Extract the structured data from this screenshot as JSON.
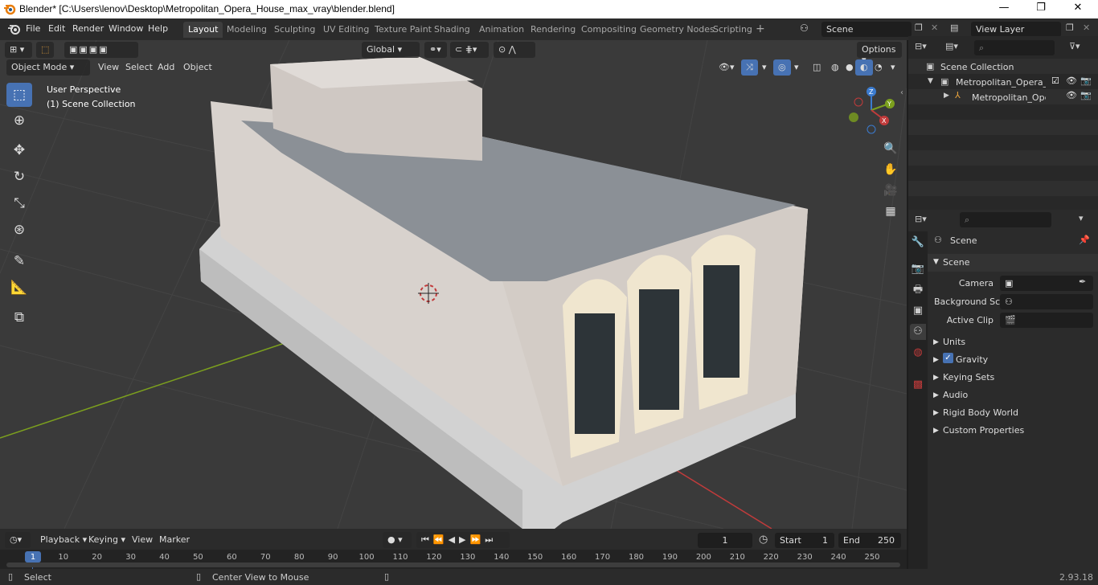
{
  "window": {
    "title": "Blender* [C:\\Users\\lenov\\Desktop\\Metropolitan_Opera_House_max_vray\\blender.blend]",
    "minimize": "—",
    "maximize": "❐",
    "close": "✕"
  },
  "menu": [
    "File",
    "Edit",
    "Render",
    "Window",
    "Help"
  ],
  "workspaces": [
    "Layout",
    "Modeling",
    "Sculpting",
    "UV Editing",
    "Texture Paint",
    "Shading",
    "Animation",
    "Rendering",
    "Compositing",
    "Geometry Nodes",
    "Scripting"
  ],
  "scene": {
    "label": "Scene",
    "view_layer": "View Layer"
  },
  "viewport": {
    "mode": "Object Mode",
    "menus": [
      "View",
      "Select",
      "Add",
      "Object"
    ],
    "orientation": "Global",
    "options": "Options",
    "perspective": "User Perspective",
    "collection": "(1) Scene Collection",
    "gizmo": {
      "z": "Z",
      "y": "Y",
      "x": "X"
    }
  },
  "outliner": {
    "root": "Scene Collection",
    "items": [
      "Metropolitan_Opera_House",
      "Metropolitan_Opera_H"
    ]
  },
  "properties": {
    "header": "Scene",
    "panel": "Scene",
    "fields": [
      {
        "label": "Camera"
      },
      {
        "label": "Background Sc..."
      },
      {
        "label": "Active Clip"
      }
    ],
    "sections": [
      "Units",
      "Gravity",
      "Keying Sets",
      "Audio",
      "Rigid Body World",
      "Custom Properties"
    ],
    "gravity_checked": true
  },
  "timeline": {
    "menus": [
      "Playback",
      "Keying",
      "View",
      "Marker"
    ],
    "current_frame": "1",
    "start_label": "Start",
    "start": "1",
    "end_label": "End",
    "end": "250",
    "ticks": [
      "1",
      "10",
      "20",
      "30",
      "40",
      "50",
      "60",
      "70",
      "80",
      "90",
      "100",
      "110",
      "120",
      "130",
      "140",
      "150",
      "160",
      "170",
      "180",
      "190",
      "200",
      "210",
      "220",
      "230",
      "240",
      "250"
    ]
  },
  "status": {
    "left": "Select",
    "middle": "Center View to Mouse",
    "version": "2.93.18"
  },
  "colors": {
    "accent": "#4772b3",
    "header": "#2b2b2b",
    "viewport_bg": "#3a3a3a",
    "axis_x": "#c13b3b",
    "axis_y": "#7ca01e"
  }
}
